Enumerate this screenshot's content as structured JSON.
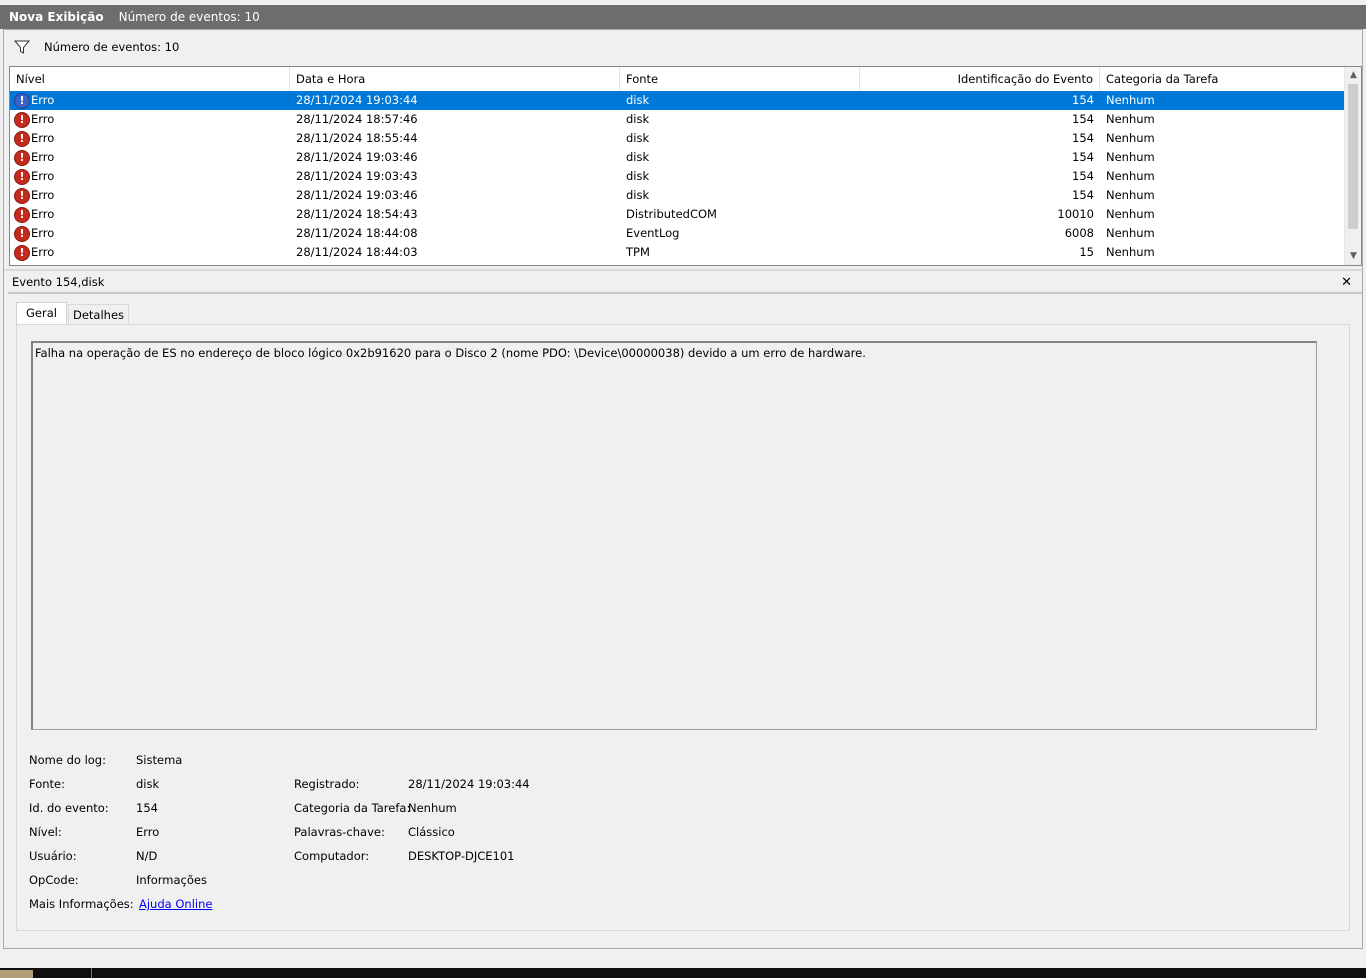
{
  "titlebar": {
    "title": "Nova Exibição",
    "count": "Número de eventos: 10"
  },
  "filter": {
    "icon": "filter-icon",
    "text": "Número de eventos: 10"
  },
  "grid": {
    "columns": [
      "Nível",
      "Data e Hora",
      "Fonte",
      "Identificação do Evento",
      "Categoria da Tarefa"
    ],
    "rows": [
      {
        "level": "Erro",
        "datetime": "28/11/2024 19:03:44",
        "source": "disk",
        "id": "154",
        "category": "Nenhum"
      },
      {
        "level": "Erro",
        "datetime": "28/11/2024 18:57:46",
        "source": "disk",
        "id": "154",
        "category": "Nenhum"
      },
      {
        "level": "Erro",
        "datetime": "28/11/2024 18:55:44",
        "source": "disk",
        "id": "154",
        "category": "Nenhum"
      },
      {
        "level": "Erro",
        "datetime": "28/11/2024 19:03:46",
        "source": "disk",
        "id": "154",
        "category": "Nenhum"
      },
      {
        "level": "Erro",
        "datetime": "28/11/2024 19:03:43",
        "source": "disk",
        "id": "154",
        "category": "Nenhum"
      },
      {
        "level": "Erro",
        "datetime": "28/11/2024 19:03:46",
        "source": "disk",
        "id": "154",
        "category": "Nenhum"
      },
      {
        "level": "Erro",
        "datetime": "28/11/2024 18:54:43",
        "source": "DistributedCOM",
        "id": "10010",
        "category": "Nenhum"
      },
      {
        "level": "Erro",
        "datetime": "28/11/2024 18:44:08",
        "source": "EventLog",
        "id": "6008",
        "category": "Nenhum"
      },
      {
        "level": "Erro",
        "datetime": "28/11/2024 18:44:03",
        "source": "TPM",
        "id": "15",
        "category": "Nenhum"
      }
    ],
    "selected_index": 0
  },
  "detail": {
    "header": "Evento 154,disk",
    "tabs": [
      "Geral",
      "Detalhes"
    ],
    "description": "Falha na operação de ES no endereço de bloco lógico 0x2b91620 para o Disco 2 (nome PDO: \\Device\\00000038) devido a um erro de hardware.",
    "props": {
      "log_label": "Nome do log:",
      "log_value": "Sistema",
      "source_label": "Fonte:",
      "source_value": "disk",
      "eventid_label": "Id. do evento:",
      "eventid_value": "154",
      "level_label": "Nível:",
      "level_value": "Erro",
      "user_label": "Usuário:",
      "user_value": "N/D",
      "opcode_label": "OpCode:",
      "opcode_value": "Informações",
      "moreinfo_label": "Mais Informações:",
      "moreinfo_link": "Ajuda Online",
      "logged_label": "Registrado:",
      "logged_value": "28/11/2024 19:03:44",
      "category_label": "Categoria da Tarefa:",
      "category_value": "Nenhum",
      "keywords_label": "Palavras-chave:",
      "keywords_value": "Clássico",
      "computer_label": "Computador:",
      "computer_value": "DESKTOP-DJCE101"
    }
  },
  "colors": {
    "selection": "#0078d7",
    "titlebar": "#6d6d6d",
    "error": "#c42b1c",
    "link": "#0000ee"
  }
}
